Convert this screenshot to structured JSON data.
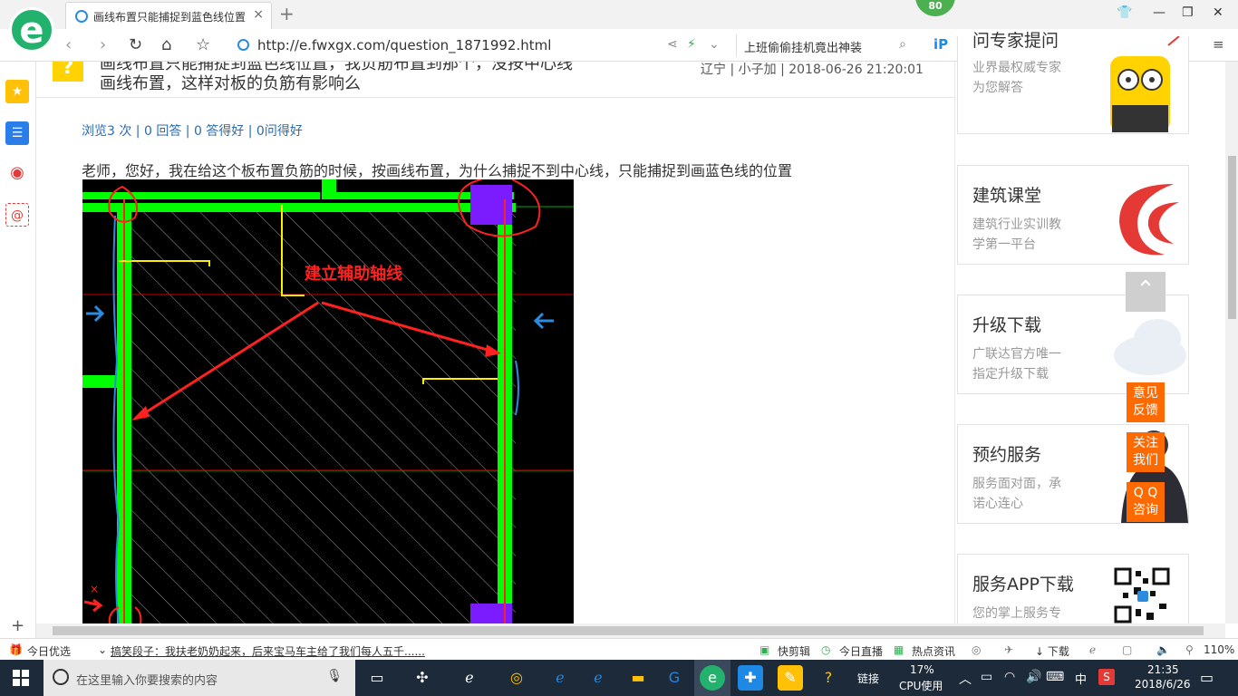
{
  "browser": {
    "tab_title": "画线布置只能捕捉到蓝色线位置",
    "tab_close": "×",
    "new_tab": "+",
    "badge": "80",
    "url": "http://e.fwxgx.com/question_1871992.html",
    "search_text": "上班偷偷挂机竟出神装"
  },
  "question": {
    "title_line1": "画线布置只能捕捉到蓝色线位置，我负筋布置到那个，没按中心线",
    "title_line2": "画线布置，这样对板的负筋有影响么",
    "meta": "辽宁 | 小子加 | 2018-06-26 21:20:01",
    "stats": "浏览3 次 | 0 回答 | 0 答得好 | 0问得好",
    "body": "老师，您好，我在给这个板布置负筋的时候，按画线布置，为什么捕捉不到中心线，只能捕捉到画蓝色线的位置",
    "annotation": "建立辅助轴线"
  },
  "right_cards": [
    {
      "title": "问专家提问",
      "sub1": "业界最权威专家",
      "sub2": "为您解答"
    },
    {
      "title": "建筑课堂",
      "sub1": "建筑行业实训教",
      "sub2": "学第一平台"
    },
    {
      "title": "升级下载",
      "sub1": "广联达官方唯一",
      "sub2": "指定升级下载"
    },
    {
      "title": "预约服务",
      "sub1": "服务面对面，承",
      "sub2": "诺心连心"
    },
    {
      "title": "服务APP下载",
      "sub1": "您的掌上服务专",
      "sub2": ""
    }
  ],
  "float_buttons": [
    "意见反馈",
    "关注我们",
    "QQ咨询"
  ],
  "float_lines": [
    [
      "意见",
      "反馈"
    ],
    [
      "关注",
      "我们"
    ],
    [
      "Q Q",
      "咨询"
    ]
  ],
  "statusbar": {
    "today_pick": "今日优选",
    "news": "搞笑段子：我扶老奶奶起来，后来宝马车主给了我们每人五千......",
    "quick_clip": "快剪辑",
    "live": "今日直播",
    "hot_news": "热点资讯",
    "download": "下载",
    "zoom": "110%"
  },
  "taskbar": {
    "search_placeholder": "在这里输入你要搜索的内容",
    "link_label": "链接",
    "cpu_percent": "17%",
    "cpu_label": "CPU使用",
    "ime": "中",
    "time": "21:35",
    "date": "2018/6/26"
  },
  "colors": {
    "accent": "#23b26d",
    "link": "#2b6cb0",
    "orange": "#ff6a00",
    "cad_green": "#00ff00",
    "cad_purple": "#7a1cff",
    "annotation_red": "#ff2020"
  }
}
